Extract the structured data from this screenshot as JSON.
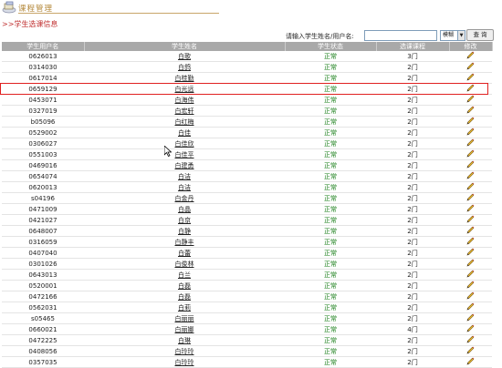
{
  "header": {
    "title": "课程管理"
  },
  "breadcrumb": {
    "arrows": ">>",
    "label": "学生选课信息"
  },
  "search": {
    "label": "请输入学生姓名/用户名:",
    "value": "",
    "mode": "模糊",
    "button": "查 询"
  },
  "table": {
    "columns": [
      "学生用户名",
      "学生姓名",
      "学生状态",
      "选课课程",
      "修改"
    ],
    "rows": [
      {
        "id": "0626013",
        "name": "白歌",
        "status": "正常",
        "courses": "3门"
      },
      {
        "id": "0314030",
        "name": "白鸽",
        "status": "正常",
        "courses": "2门"
      },
      {
        "id": "0617014",
        "name": "白桂勤",
        "status": "正常",
        "courses": "2门"
      },
      {
        "id": "0659129",
        "name": "白光远",
        "status": "正常",
        "courses": "2门"
      },
      {
        "id": "0453071",
        "name": "白海伟",
        "status": "正常",
        "courses": "2门"
      },
      {
        "id": "0327019",
        "name": "白宏轩",
        "status": "正常",
        "courses": "2门"
      },
      {
        "id": "b05096",
        "name": "白红梅",
        "status": "正常",
        "courses": "2门"
      },
      {
        "id": "0529002",
        "name": "白佳",
        "status": "正常",
        "courses": "2门"
      },
      {
        "id": "0306027",
        "name": "白佳欣",
        "status": "正常",
        "courses": "2门"
      },
      {
        "id": "0551003",
        "name": "白佳平",
        "status": "正常",
        "courses": "2门"
      },
      {
        "id": "0469016",
        "name": "白建勇",
        "status": "正常",
        "courses": "2门"
      },
      {
        "id": "0654074",
        "name": "白洁",
        "status": "正常",
        "courses": "2门"
      },
      {
        "id": "0620013",
        "name": "白洁",
        "status": "正常",
        "courses": "2门"
      },
      {
        "id": "s04196",
        "name": "白金丹",
        "status": "正常",
        "courses": "2门"
      },
      {
        "id": "0471009",
        "name": "白晶",
        "status": "正常",
        "courses": "2门"
      },
      {
        "id": "0421027",
        "name": "白京",
        "status": "正常",
        "courses": "2门"
      },
      {
        "id": "0648007",
        "name": "白静",
        "status": "正常",
        "courses": "2门"
      },
      {
        "id": "0316059",
        "name": "白静丰",
        "status": "正常",
        "courses": "2门"
      },
      {
        "id": "0407040",
        "name": "白蕾",
        "status": "正常",
        "courses": "2门"
      },
      {
        "id": "0301026",
        "name": "白俊林",
        "status": "正常",
        "courses": "2门"
      },
      {
        "id": "0643013",
        "name": "白兰",
        "status": "正常",
        "courses": "2门"
      },
      {
        "id": "0520001",
        "name": "白磊",
        "status": "正常",
        "courses": "2门"
      },
      {
        "id": "0472166",
        "name": "白磊",
        "status": "正常",
        "courses": "2门"
      },
      {
        "id": "0562031",
        "name": "白莉",
        "status": "正常",
        "courses": "2门"
      },
      {
        "id": "s05465",
        "name": "白丽丽",
        "status": "正常",
        "courses": "2门"
      },
      {
        "id": "0660021",
        "name": "白丽娜",
        "status": "正常",
        "courses": "4门"
      },
      {
        "id": "0472225",
        "name": "白琳",
        "status": "正常",
        "courses": "2门"
      },
      {
        "id": "0408056",
        "name": "白玲玲",
        "status": "正常",
        "courses": "2门"
      },
      {
        "id": "0357035",
        "name": "白玲玲",
        "status": "正常",
        "courses": "2门"
      }
    ]
  },
  "colors": {
    "accent": "#b58a3c",
    "crumb": "#c03030",
    "status": "#1a7f1a",
    "header_bg": "#a9a9a9",
    "highlight": "#e02020"
  },
  "icons": {
    "logo": "book-stack-icon",
    "edit": "pencil-icon",
    "cursor": "mouse-pointer-icon"
  }
}
